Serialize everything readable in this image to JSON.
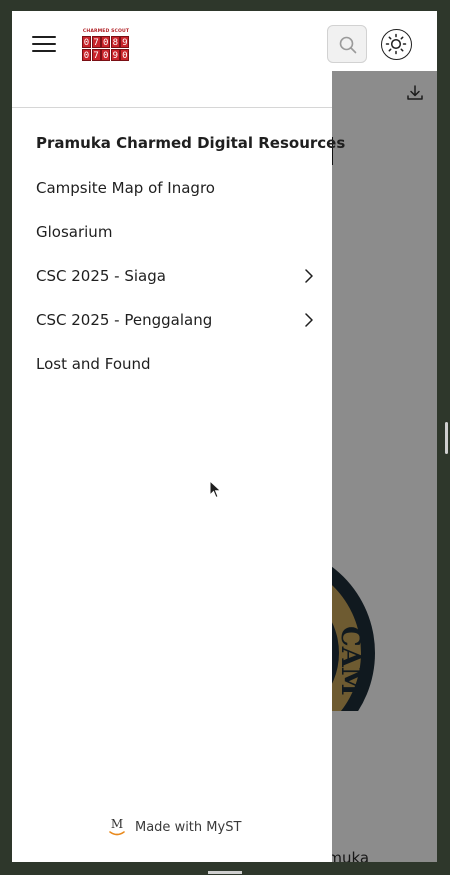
{
  "logo": {
    "caption": "CHARMED SCOUT",
    "row1": [
      "0",
      "7",
      "0",
      "8",
      "9"
    ],
    "row2": [
      "0",
      "7",
      "0",
      "9",
      "0"
    ]
  },
  "header": {
    "menu_icon": "hamburger-menu-icon",
    "search_icon": "search-icon",
    "theme_icon": "sun-icon"
  },
  "drawer": {
    "title": "Pramuka Charmed Digital Resources",
    "items": [
      {
        "label": "Campsite Map of Inagro",
        "has_children": false
      },
      {
        "label": "Glosarium",
        "has_children": false
      },
      {
        "label": "CSC 2025 - Siaga",
        "has_children": true
      },
      {
        "label": "CSC 2025 - Penggalang",
        "has_children": true
      },
      {
        "label": "Lost and Found",
        "has_children": false
      }
    ],
    "footer": "Made with MyST"
  },
  "main": {
    "download_icon": "download-icon",
    "partial_text": "ramuka"
  },
  "colors": {
    "backdrop": "#2e372b",
    "seal_ring": "#1e2f3a",
    "seal_gold": "#c9a65a",
    "logo_red": "#c9242b"
  }
}
